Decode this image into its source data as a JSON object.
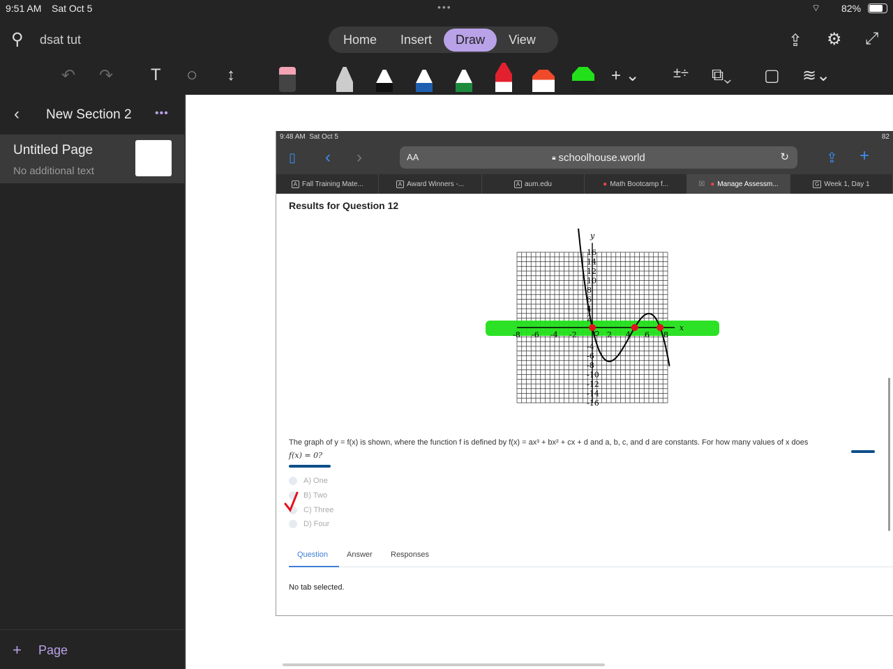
{
  "status": {
    "time": "9:51 AM",
    "date": "Sat Oct 5",
    "battery": "82%"
  },
  "header": {
    "notebook": "dsat tut",
    "tabs": [
      "Home",
      "Insert",
      "Draw",
      "View"
    ],
    "active_tab": "Draw"
  },
  "sidebar": {
    "section": "New Section 2",
    "page_title": "Untitled Page",
    "page_subtitle": "No additional text",
    "add_page": "Page"
  },
  "screenshot": {
    "status_time": "9:48 AM",
    "status_date": "Sat Oct 5",
    "battery": "82",
    "text_size": "AA",
    "url": "schoolhouse.world",
    "tabs": [
      {
        "icon": "A",
        "label": "Fall Training Mate..."
      },
      {
        "icon": "A",
        "label": "Award Winners -..."
      },
      {
        "icon": "A",
        "label": "aum.edu"
      },
      {
        "icon": "",
        "label": "Math Bootcamp f..."
      },
      {
        "icon": "",
        "label": "Manage Assessm..."
      },
      {
        "icon": "G",
        "label": "Week 1, Day 1"
      }
    ],
    "heading": "Results for Question 12",
    "question_line1": "The graph of y = f(x) is shown, where the function f is defined by f(x) = ax³ + bx² + cx + d and a, b, c, and d are constants. For how many values of x does",
    "question_line2": "f(x) = 0?",
    "options": [
      "A) One",
      "B) Two",
      "C) Three",
      "D) Four"
    ],
    "result_tabs": [
      "Question",
      "Answer",
      "Responses"
    ],
    "empty_text": "No tab selected.",
    "graph": {
      "x_label": "x",
      "y_label": "y",
      "y_ticks": [
        "16",
        "14",
        "12",
        "10",
        "8",
        "6",
        "4",
        "2",
        "-4",
        "-6",
        "-8",
        "-10",
        "-12",
        "-14",
        "-16"
      ],
      "x_ticks": [
        "-8",
        "-6",
        "-4",
        "-2",
        "2",
        "4",
        "6",
        "8"
      ],
      "origin": "O"
    }
  }
}
